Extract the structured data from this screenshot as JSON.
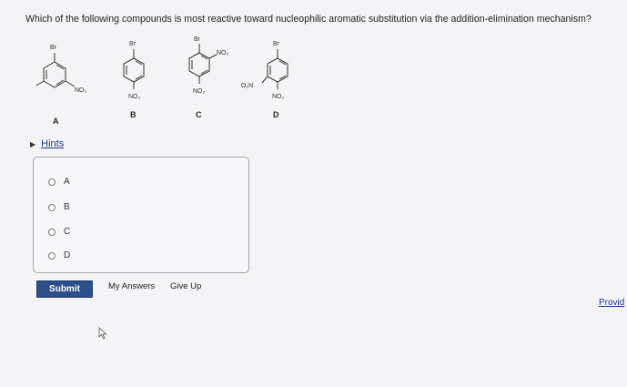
{
  "question": {
    "text": "Which of the following compounds is most reactive toward nucleophilic aromatic substitution via the addition-elimination mechanism?"
  },
  "molecules": [
    {
      "label": "A",
      "substituents": {
        "br": "Br",
        "no2": "NO₂"
      }
    },
    {
      "label": "B",
      "substituents": {
        "br": "Br",
        "no2": "NO₂"
      }
    },
    {
      "label": "C",
      "substituents": {
        "br": "Br",
        "no2_top": "NO₂",
        "no2_bottom": "NO₂"
      }
    },
    {
      "label": "D",
      "substituents": {
        "br": "Br",
        "o2n": "O₂N",
        "no2": "NO₂"
      }
    }
  ],
  "hints": {
    "label": "Hints",
    "icon": "triangle-right-icon"
  },
  "choices": [
    {
      "label": "A"
    },
    {
      "label": "B"
    },
    {
      "label": "C"
    },
    {
      "label": "D"
    }
  ],
  "actions": {
    "submit_label": "Submit",
    "my_answers_label": "My Answers",
    "give_up_label": "Give Up",
    "provide_label": "Provid"
  },
  "colors": {
    "submit_bg": "#2c4f8a",
    "link": "#1c3a8a",
    "background": "#f4f4f6"
  }
}
